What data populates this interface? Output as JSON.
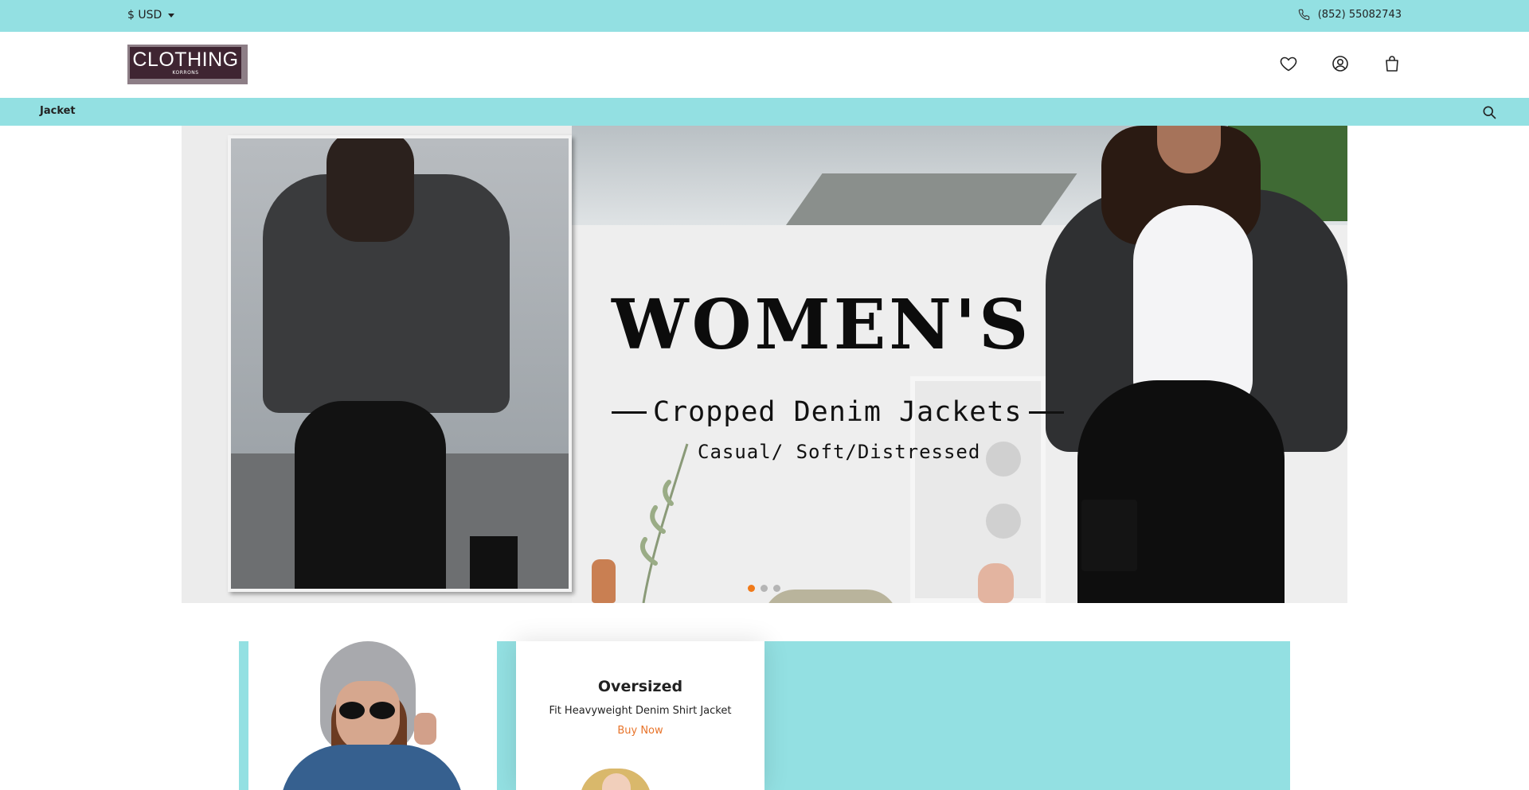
{
  "topbar": {
    "currency": "$ USD",
    "phone": "(852) 55082743",
    "phone_icon": "phone-icon"
  },
  "header": {
    "logo": {
      "main": "CLOTHING",
      "sub": "KORRONS"
    },
    "icons": [
      "heart-icon",
      "user-icon",
      "bag-icon"
    ]
  },
  "nav": {
    "items": [
      {
        "label": "Jacket"
      }
    ],
    "search_icon": "search-icon"
  },
  "hero": {
    "title": "WOMEN'S",
    "subtitle": "Cropped Denim Jackets",
    "tagline": "Casual/ Soft/Distressed",
    "slides": 3,
    "active_slide": 1
  },
  "promo": {
    "title": "Oversized",
    "description": "Fit Heavyweight Denim Shirt Jacket",
    "cta": "Buy Now"
  },
  "colors": {
    "accent_bar": "#93e0e2",
    "cta": "#e8742a",
    "active_dot": "#f07a1a",
    "logo_bg": "#3f2532"
  }
}
